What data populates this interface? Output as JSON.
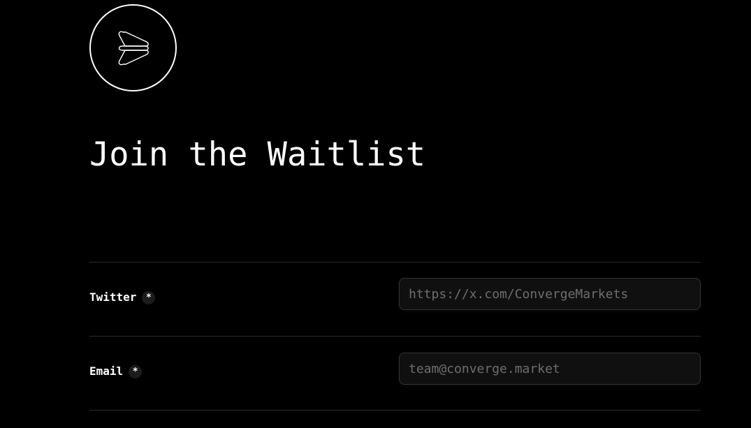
{
  "logo": {
    "icon": "converge-logo-icon"
  },
  "header": {
    "title": "Join the Waitlist"
  },
  "form": {
    "twitter": {
      "label": "Twitter",
      "required_mark": "*",
      "placeholder": "https://x.com/ConvergeMarkets",
      "value": ""
    },
    "email": {
      "label": "Email",
      "required_mark": "*",
      "placeholder": "team@converge.market",
      "value": ""
    }
  },
  "colors": {
    "background": "#000000",
    "text": "#ffffff",
    "divider": "#2a2a2a",
    "input_bg": "#101010",
    "input_border": "#343434",
    "placeholder": "#6e6e6e"
  }
}
